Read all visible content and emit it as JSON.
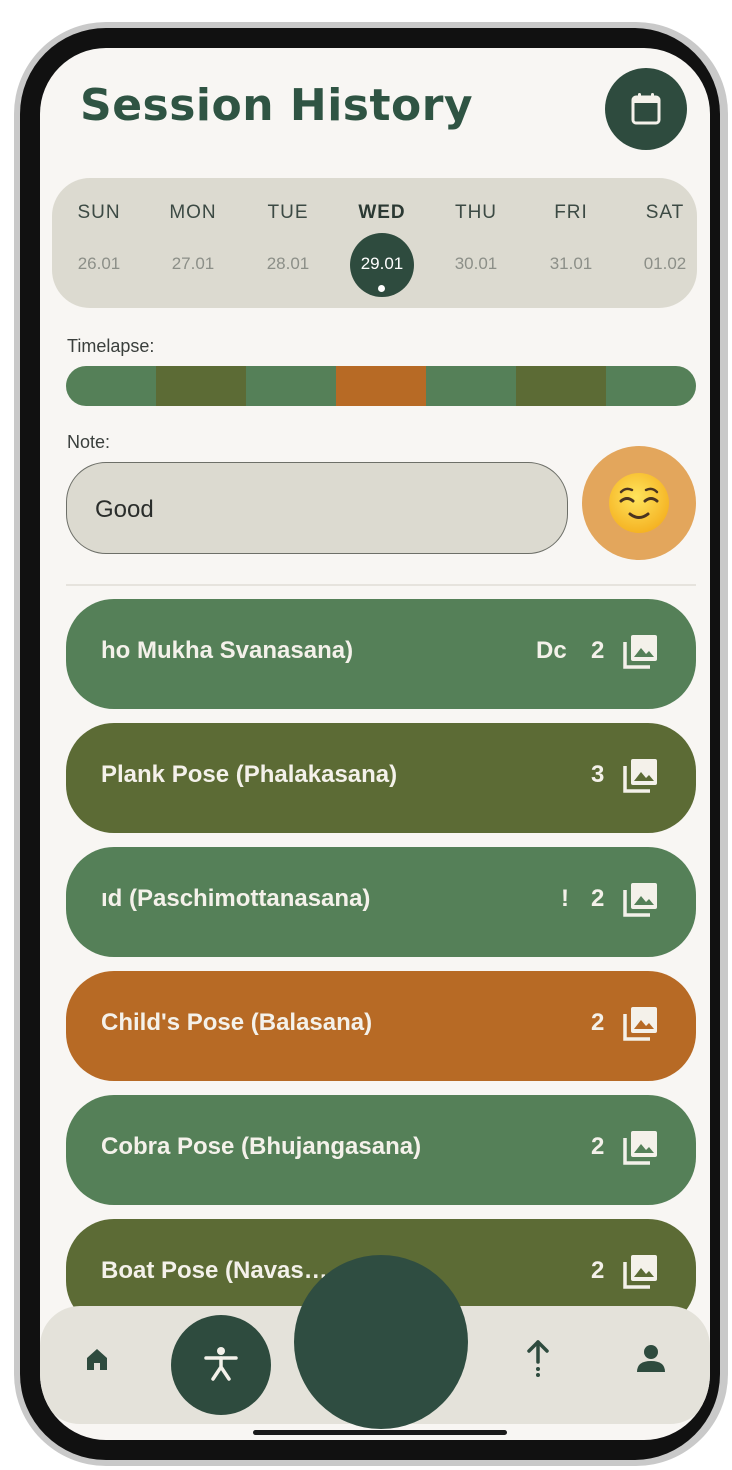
{
  "header": {
    "title": "Session History",
    "calendar_icon": "calendar-icon"
  },
  "week": {
    "days": [
      {
        "name": "SUN",
        "date": "26.01"
      },
      {
        "name": "MON",
        "date": "27.01"
      },
      {
        "name": "TUE",
        "date": "28.01"
      },
      {
        "name": "WED",
        "date": "29.01",
        "selected": true
      },
      {
        "name": "THU",
        "date": "30.01"
      },
      {
        "name": "FRI",
        "date": "31.01"
      },
      {
        "name": "SAT",
        "date": "01.02"
      }
    ]
  },
  "timelapse": {
    "label": "Timelapse:",
    "segments": [
      "#558058",
      "#5c6b35",
      "#558058",
      "#b76a25",
      "#558058",
      "#5c6b35",
      "#558058"
    ]
  },
  "note": {
    "label": "Note:",
    "value": "Good",
    "mood_icon": "relieved-face-emoji-icon"
  },
  "poses": [
    {
      "name": "ho Mukha Svanasana)",
      "count": "2",
      "trail": "Dc",
      "color": "#558058"
    },
    {
      "name": "Plank Pose (Phalakasana)",
      "count": "3",
      "trail": "",
      "color": "#5c6b35"
    },
    {
      "name": "ıd (Paschimottanasana)",
      "count": "2",
      "trail": "!",
      "color": "#558058"
    },
    {
      "name": "Child's Pose (Balasana)",
      "count": "2",
      "trail": "",
      "color": "#b76a25"
    },
    {
      "name": "Cobra Pose (Bhujangasana)",
      "count": "2",
      "trail": "",
      "color": "#558058"
    },
    {
      "name": "Boat Pose (Navas…",
      "count": "2",
      "trail": "",
      "color": "#5c6b35"
    }
  ],
  "nav": {
    "items": [
      "home-icon",
      "exercise-icon",
      "upload-arrow-icon",
      "profile-icon"
    ]
  },
  "colors": {
    "primary_dark": "#2e4b3e",
    "sage": "#558058",
    "olive": "#5c6b35",
    "orange": "#b76a25",
    "background": "#f8f6f3",
    "surface": "#dcdad0"
  }
}
